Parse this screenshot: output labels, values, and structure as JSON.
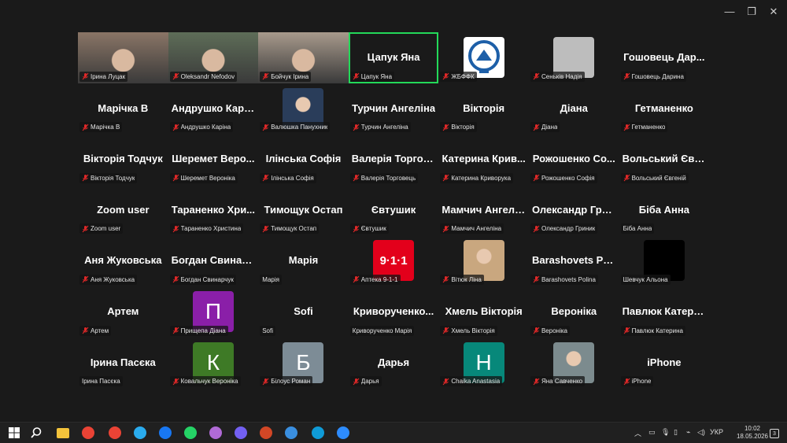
{
  "window": {
    "minimize": "—",
    "restore": "❐",
    "close": "✕"
  },
  "tiles": [
    {
      "name": "",
      "label": "Ірина Луцак",
      "kind": "video",
      "bg": "#8a7566"
    },
    {
      "name": "",
      "label": "Oleksandr Nefodov",
      "kind": "video",
      "bg": "#5e6d58"
    },
    {
      "name": "",
      "label": "Бойчук Ірина",
      "kind": "video",
      "bg": "#a89a8c"
    },
    {
      "name": "Цапук Яна",
      "label": "Цапук Яна",
      "kind": "name",
      "active": true
    },
    {
      "name": "",
      "label": "ЖБФФК",
      "kind": "logo",
      "bg": "#ffffff"
    },
    {
      "name": "",
      "label": "Сеньків Надія",
      "kind": "blank",
      "bg": "#bdbdbd"
    },
    {
      "name": "Гошовець Дар...",
      "label": "Гошовець Дарина",
      "kind": "name"
    },
    {
      "name": "Марічка В",
      "label": "Марічка В",
      "kind": "name"
    },
    {
      "name": "Андрушко Карі...",
      "label": "Андрушко Каріна",
      "kind": "name"
    },
    {
      "name": "",
      "label": "Валюшка Панухник",
      "kind": "photo",
      "bg": "#2a3d5a"
    },
    {
      "name": "Турчин Ангеліна",
      "label": "Турчин Ангеліна",
      "kind": "name"
    },
    {
      "name": "Вікторія",
      "label": "Вікторія",
      "kind": "name"
    },
    {
      "name": "Діана",
      "label": "Діана",
      "kind": "name"
    },
    {
      "name": "Гетманенко",
      "label": "Гетманенко",
      "kind": "name"
    },
    {
      "name": "Вікторія Тодчук",
      "label": "Вікторія Тодчук",
      "kind": "name"
    },
    {
      "name": "Шеремет Веро...",
      "label": "Шеремет Вероніка",
      "kind": "name"
    },
    {
      "name": "Ілінська Софія",
      "label": "Ілінська Софія",
      "kind": "name"
    },
    {
      "name": "Валерія Торгов...",
      "label": "Валерія Торговець",
      "kind": "name"
    },
    {
      "name": "Катерина Крив...",
      "label": "Катерина Криворука",
      "kind": "name"
    },
    {
      "name": "Рожошенко Со...",
      "label": "Рожошенко Софія",
      "kind": "name"
    },
    {
      "name": "Вольський Євг...",
      "label": "Вольський Євгеній",
      "kind": "name"
    },
    {
      "name": "Zoom user",
      "label": "Zoom user",
      "kind": "name"
    },
    {
      "name": "Тараненко Хри...",
      "label": "Тараненко Христина",
      "kind": "name"
    },
    {
      "name": "Тимощук Остап",
      "label": "Тимощук Остап",
      "kind": "name"
    },
    {
      "name": "Євтушик",
      "label": "Євтушик",
      "kind": "name"
    },
    {
      "name": "Мамчич Ангелі...",
      "label": "Мамчич Ангеліна",
      "kind": "name"
    },
    {
      "name": "Олександр Гри...",
      "label": "Олександр Гриник",
      "kind": "name"
    },
    {
      "name": "Біба Анна",
      "label": "Біба Анна",
      "kind": "name",
      "nomute": true
    },
    {
      "name": "Аня Жуковська",
      "label": "Аня Жуковська",
      "kind": "name"
    },
    {
      "name": "Богдан Свинар...",
      "label": "Богдан Свинарчук",
      "kind": "name"
    },
    {
      "name": "Марія",
      "label": "Марія",
      "kind": "name",
      "nomute": true
    },
    {
      "name": "",
      "label": "Аптека 9-1-1",
      "kind": "logo911",
      "bg": "#e3001b",
      "text": "9·1·1"
    },
    {
      "name": "",
      "label": "Вітюк Ліна",
      "kind": "photo",
      "bg": "#c9a77f"
    },
    {
      "name": "Barashovets Pol...",
      "label": "Barashovets Polina",
      "kind": "name"
    },
    {
      "name": "",
      "label": "Шевчук Альона",
      "kind": "blank",
      "bg": "#000000",
      "nomute": true
    },
    {
      "name": "Артем",
      "label": "Артем",
      "kind": "name"
    },
    {
      "name": "",
      "label": "Прищепа Діана",
      "kind": "letter",
      "letter": "П",
      "bg": "#8a1fa8"
    },
    {
      "name": "Sofi",
      "label": "Sofi",
      "kind": "name",
      "nomute": true
    },
    {
      "name": "Криворученко...",
      "label": "Криворученко Марія",
      "kind": "name",
      "nomute": true
    },
    {
      "name": "Хмель Вікторія",
      "label": "Хмель Вікторія",
      "kind": "name"
    },
    {
      "name": "Вероніка",
      "label": "Вероніка",
      "kind": "name"
    },
    {
      "name": "Павлюк Катери...",
      "label": "Павлюк Катерина",
      "kind": "name"
    },
    {
      "name": "Ірина Пасєка",
      "label": "Ірина Пасєка",
      "kind": "name",
      "nomute": true
    },
    {
      "name": "",
      "label": "Ковальчук Вероніка",
      "kind": "letter",
      "letter": "К",
      "bg": "#3e7a26"
    },
    {
      "name": "",
      "label": "Білоус Роман",
      "kind": "letter",
      "letter": "Б",
      "bg": "#7d8c96"
    },
    {
      "name": "Дарья",
      "label": "Дарья",
      "kind": "name"
    },
    {
      "name": "",
      "label": "Chaika Anastasia",
      "kind": "letter",
      "letter": "Н",
      "bg": "#07887a"
    },
    {
      "name": "",
      "label": "Яна Савченко",
      "kind": "photo",
      "bg": "#7c8b8e"
    },
    {
      "name": "iPhone",
      "label": "iPhone",
      "kind": "name"
    }
  ],
  "taskbar": {
    "apps": [
      {
        "icon": "windows-start-icon",
        "color": "#ffffff"
      },
      {
        "icon": "search-icon",
        "color": "#ffffff"
      },
      {
        "icon": "file-explorer-icon",
        "color": "#f3c33b"
      },
      {
        "icon": "chrome-icon",
        "color": "#ea4335"
      },
      {
        "icon": "chrome-icon",
        "color": "#ea4335"
      },
      {
        "icon": "telegram-icon",
        "color": "#2aabee"
      },
      {
        "icon": "messenger-icon",
        "color": "#1877f2"
      },
      {
        "icon": "whatsapp-icon",
        "color": "#25d366"
      },
      {
        "icon": "maps-icon",
        "color": "#b06ad6"
      },
      {
        "icon": "viber-icon",
        "color": "#7360f2"
      },
      {
        "icon": "powerpoint-icon",
        "color": "#d24726"
      },
      {
        "icon": "media-player-icon",
        "color": "#3a8fe0"
      },
      {
        "icon": "edge-icon",
        "color": "#0f9bd7"
      },
      {
        "icon": "zoom-icon",
        "color": "#2d8cff"
      }
    ],
    "tray": {
      "lang": "УКР",
      "time": "10:02",
      "date": "18.05.2026",
      "notifications": "3"
    }
  }
}
